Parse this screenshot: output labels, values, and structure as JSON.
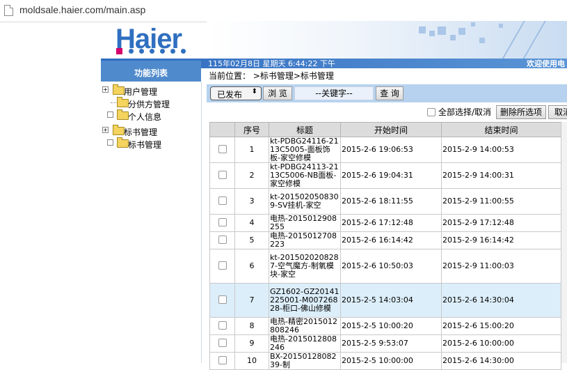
{
  "browser": {
    "url": "moldsale.haier.com/main.asp"
  },
  "header": {
    "logo_text": "Haier",
    "datetime": "115年02月8日 星期天 6:44:22 下午",
    "welcome": "欢迎使用电",
    "colors": {
      "brand_blue": "#2f6fc0",
      "brand_pink": "#d4006c",
      "bar_blue": "#4f8acc"
    }
  },
  "sidebar": {
    "title": "功能列表",
    "items": [
      {
        "label": "用户管理",
        "toggle": "+",
        "icon": "folder-icon"
      },
      {
        "label": "分供方管理",
        "icon": "folder-icon"
      },
      {
        "label": "个人信息",
        "icon": "folder-icon"
      },
      {
        "label": "标书管理",
        "toggle": "+",
        "icon": "folder-icon"
      },
      {
        "label": "标书管理",
        "icon": "folder-icon"
      }
    ]
  },
  "main": {
    "breadcrumb": "当前位置：  >标书管理>标书管理",
    "filter": {
      "status_value": "已发布",
      "browse_label": "浏 览",
      "keyword_placeholder": "--关键字--",
      "search_label": "查 询"
    },
    "actions": {
      "select_all_label": "全部选择/取消",
      "delete_label": "删除所选项",
      "cancel_label": "取消"
    },
    "table": {
      "columns": [
        "",
        "序号",
        "标题",
        "开始时间",
        "结束时间"
      ],
      "rows": [
        {
          "no": "1",
          "title": "kt-PDBG24116-2113C5005-面板饰板-家空修模",
          "start": "2015-2-6 19:06:53",
          "end": "2015-2-9 14:00:53"
        },
        {
          "no": "2",
          "title": "kt-PDBG24113-2113C5006-NB面板-家空修模",
          "start": "2015-2-6 19:04:31",
          "end": "2015-2-9 14:00:31"
        },
        {
          "no": "3",
          "title": "kt-2015020508309-SV挂机-家空",
          "start": "2015-2-6 18:11:55",
          "end": "2015-2-9 11:00:55"
        },
        {
          "no": "4",
          "title": "电热-2015012908255",
          "start": "2015-2-6 17:12:48",
          "end": "2015-2-9 17:12:48"
        },
        {
          "no": "5",
          "title": "电热-2015012708223",
          "start": "2015-2-6 16:14:42",
          "end": "2015-2-9 16:14:42"
        },
        {
          "no": "6",
          "title": "kt-2015020208287-空气魔方-制氧模块-家空",
          "start": "2015-2-6 10:50:03",
          "end": "2015-2-9 11:00:03"
        },
        {
          "no": "7",
          "title": "GZ1602-GZ20141225001-M00726828-柜口-佛山修模",
          "start": "2015-2-5 14:03:04",
          "end": "2015-2-6 14:30:04",
          "highlight": true
        },
        {
          "no": "8",
          "title": "电热-精密2015012808246",
          "start": "2015-2-5 10:00:20",
          "end": "2015-2-6 15:00:20"
        },
        {
          "no": "9",
          "title": "电热-2015012808246",
          "start": "2015-2-5 9:53:07",
          "end": "2015-2-6 10:00:00"
        },
        {
          "no": "10",
          "title": "BX-2015012808239-制",
          "start": "2015-2-5 10:00:00",
          "end": "2015-2-6 14:30:00"
        }
      ]
    }
  }
}
